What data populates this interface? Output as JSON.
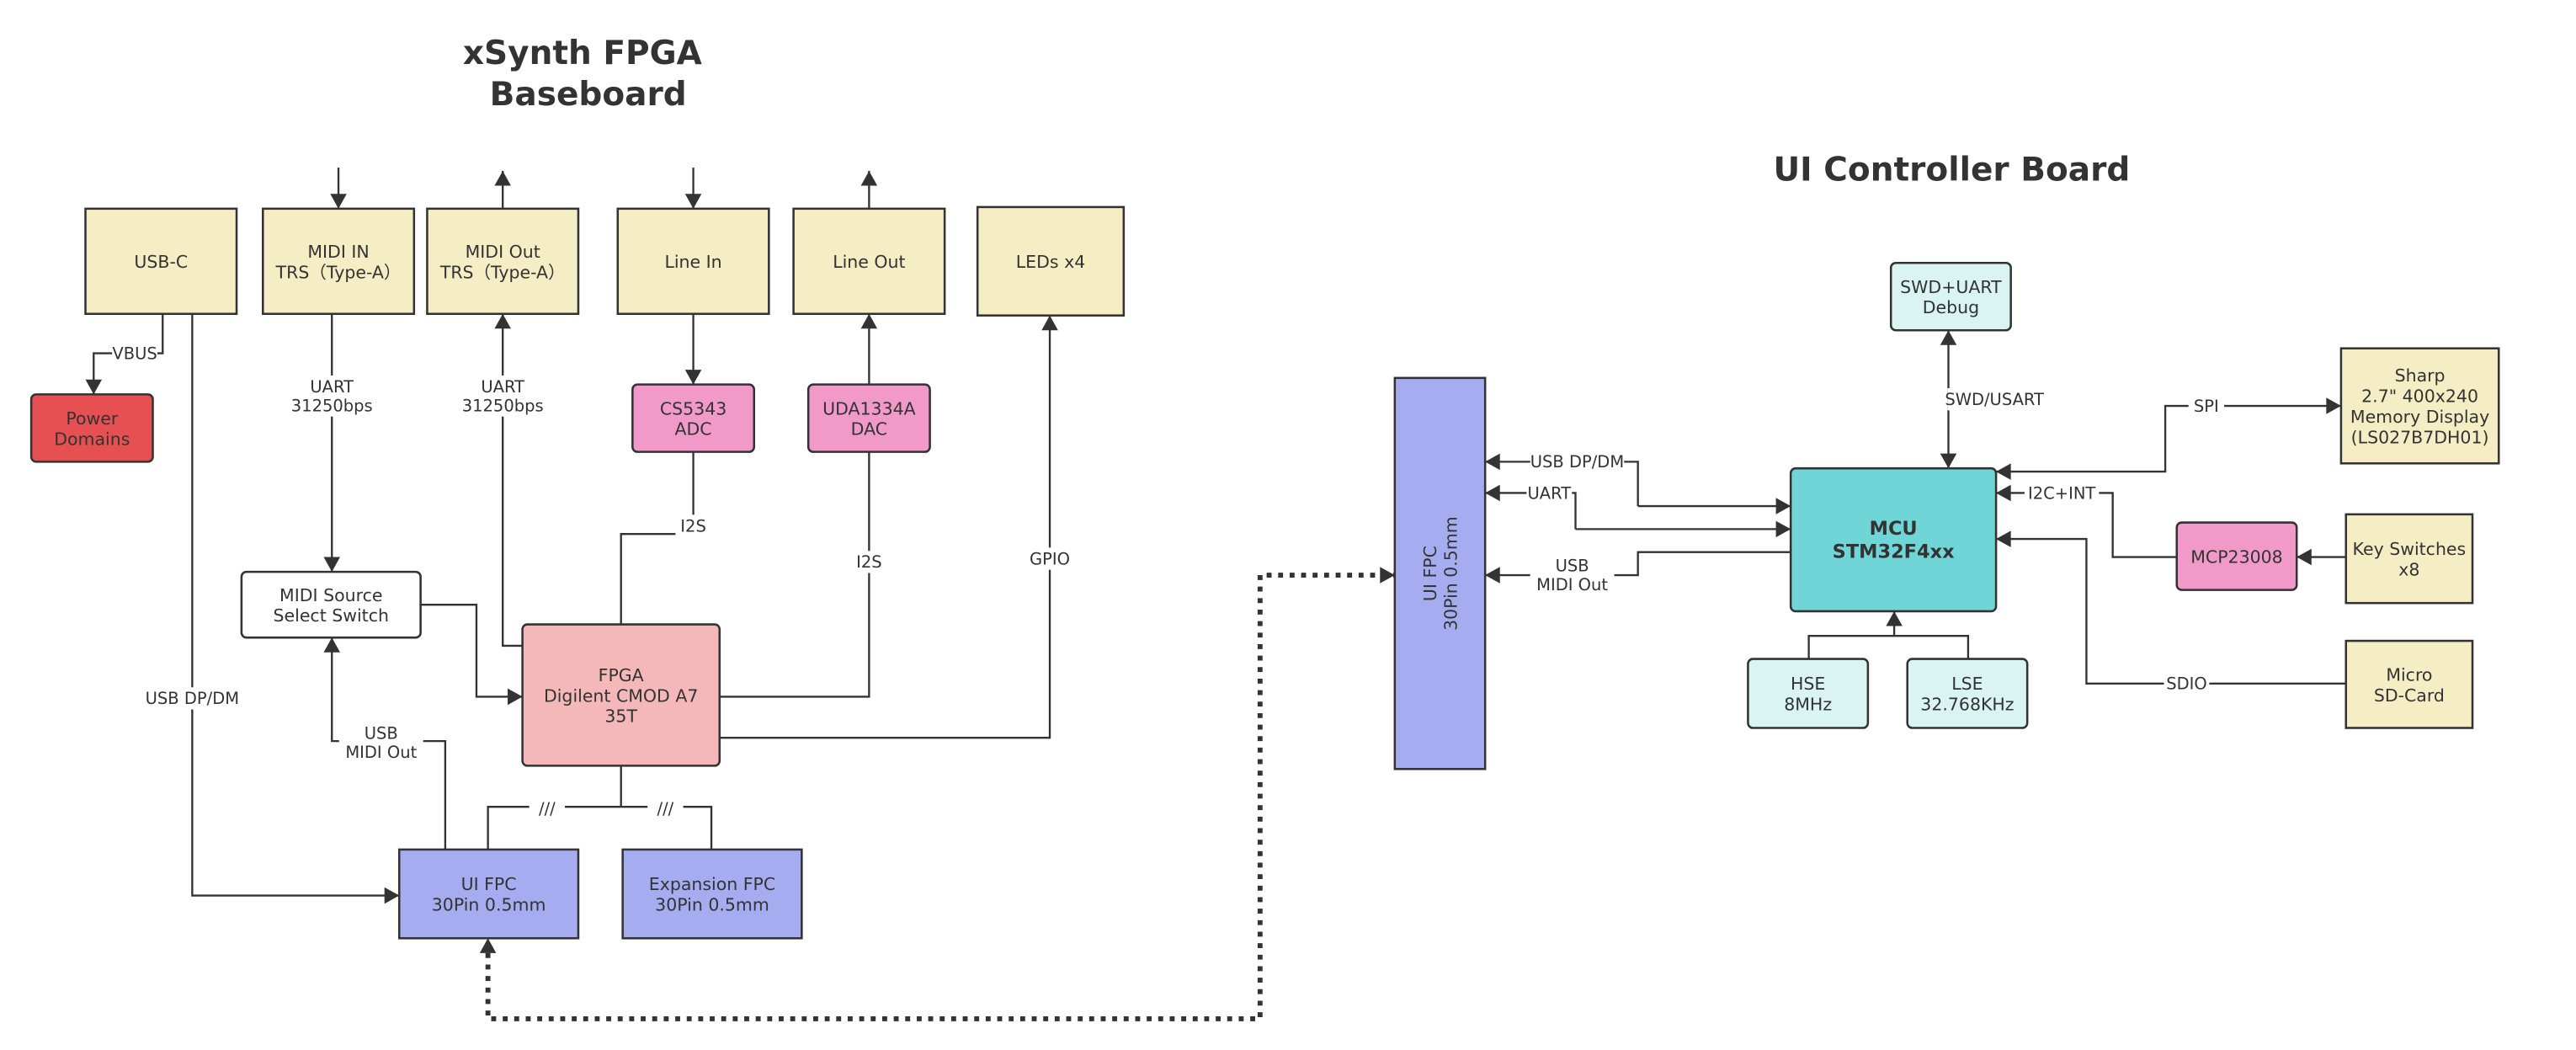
{
  "titles": {
    "baseboard": [
      "xSynth FPGA",
      "Baseboard"
    ],
    "ui_board": [
      "UI Controller Board"
    ]
  },
  "colors": {
    "connector": "#F5EDC4",
    "power": "#E65052",
    "codec": "#F19AC9",
    "switch": "#FFFFFF",
    "fpga": "#F5B8B8",
    "fpc": "#A5ADF0",
    "mcu": "#6FD5D6",
    "support": "#D9F4F3",
    "stroke": "#333333"
  },
  "baseboard": {
    "nodes": {
      "usb_c": [
        "USB-C"
      ],
      "midi_in": [
        "MIDI IN",
        "TRS（Type-A）"
      ],
      "midi_out": [
        "MIDI Out",
        "TRS（Type-A）"
      ],
      "line_in": [
        "Line In"
      ],
      "line_out": [
        "Line Out"
      ],
      "leds": [
        "LEDs x4"
      ],
      "power_domains": [
        "Power",
        "Domains"
      ],
      "adc": [
        "CS5343",
        "ADC"
      ],
      "dac": [
        "UDA1334A",
        "DAC"
      ],
      "midi_switch": [
        "MIDI Source",
        "Select Switch"
      ],
      "fpga": [
        "FPGA",
        "Digilent CMOD A7",
        "35T"
      ],
      "ui_fpc": [
        "UI FPC",
        "30Pin 0.5mm"
      ],
      "expansion_fpc": [
        "Expansion FPC",
        "30Pin 0.5mm"
      ]
    },
    "edge_labels": {
      "vbus": [
        "VBUS"
      ],
      "midi_in_uart": [
        "UART",
        "31250bps"
      ],
      "midi_out_uart": [
        "UART",
        "31250bps"
      ],
      "adc_i2s": [
        "I2S"
      ],
      "dac_i2s": [
        "I2S"
      ],
      "gpio": [
        "GPIO"
      ],
      "usb_dpdm": [
        "USB DP/DM"
      ],
      "usb_midi_out": [
        "USB",
        "MIDI Out"
      ],
      "bus_left": [
        "///"
      ],
      "bus_right": [
        "///"
      ]
    }
  },
  "ui_board": {
    "nodes": {
      "ui_fpc": [
        "UI FPC",
        "30Pin 0.5mm"
      ],
      "debug": [
        "SWD+UART",
        "Debug"
      ],
      "mcu": [
        "MCU",
        "STM32F4xx"
      ],
      "hse": [
        "HSE",
        "8MHz"
      ],
      "lse": [
        "LSE",
        "32.768KHz"
      ],
      "display": [
        "Sharp",
        "2.7\" 400x240",
        "Memory Display",
        "(LS027B7DH01)"
      ],
      "mcp": [
        "MCP23008"
      ],
      "keys": [
        "Key Switches",
        "x8"
      ],
      "sd": [
        "Micro",
        "SD-Card"
      ]
    },
    "edge_labels": {
      "usb_dpdm": [
        "USB DP/DM"
      ],
      "uart": [
        "UART"
      ],
      "usb_midi_out": [
        "USB",
        "MIDI Out"
      ],
      "swd_usart": [
        "SWD/USART"
      ],
      "spi": [
        "SPI"
      ],
      "i2c_int": [
        "I2C+INT"
      ],
      "sdio": [
        "SDIO"
      ]
    }
  }
}
